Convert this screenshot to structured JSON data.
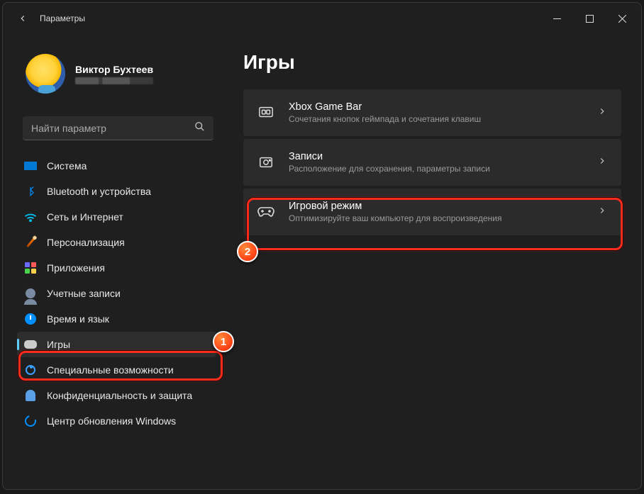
{
  "titlebar": {
    "title": "Параметры"
  },
  "profile": {
    "name": "Виктор Бухтеев"
  },
  "search": {
    "placeholder": "Найти параметр"
  },
  "nav": {
    "items": [
      {
        "label": "Система"
      },
      {
        "label": "Bluetooth и устройства"
      },
      {
        "label": "Сеть и Интернет"
      },
      {
        "label": "Персонализация"
      },
      {
        "label": "Приложения"
      },
      {
        "label": "Учетные записи"
      },
      {
        "label": "Время и язык"
      },
      {
        "label": "Игры"
      },
      {
        "label": "Специальные возможности"
      },
      {
        "label": "Конфиденциальность и защита"
      },
      {
        "label": "Центр обновления Windows"
      }
    ]
  },
  "page": {
    "title": "Игры"
  },
  "cards": [
    {
      "title": "Xbox Game Bar",
      "sub": "Сочетания кнопок геймпада и сочетания клавиш"
    },
    {
      "title": "Записи",
      "sub": "Расположение для сохранения, параметры записи"
    },
    {
      "title": "Игровой режим",
      "sub": "Оптимизируйте ваш компьютер для воспроизведения"
    }
  ],
  "callouts": {
    "one": "1",
    "two": "2"
  }
}
